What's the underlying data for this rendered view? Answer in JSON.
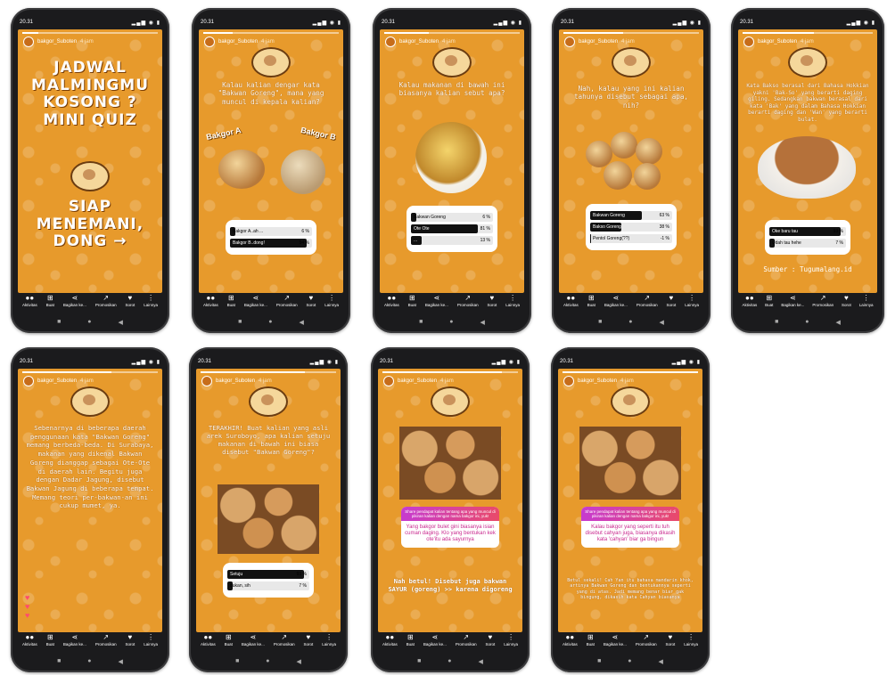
{
  "status": {
    "time": "20.31"
  },
  "story": {
    "user": "bakgor_Suboten",
    "age": "4 jam"
  },
  "actions": [
    "Aktivitas",
    "Buat",
    "Bagikan ke...",
    "Promosikan",
    "Sorot",
    "Lainnya"
  ],
  "slides": [
    {
      "big": [
        "JADWAL",
        "MALMINGMU",
        "KOSONG ?",
        "MINI QUIZ",
        "",
        "SIAP",
        "MENEMANI,",
        "DONG →"
      ]
    },
    {
      "question": "Kalau kalian dengar kata \"Bakwan Goreng\", mana yang muncul di kepala kalian?",
      "labelA": "Bakgor A",
      "labelB": "Bakgor B",
      "poll": [
        {
          "label": "Bakgor A..ah ...",
          "pct": "6 %",
          "value": 6
        },
        {
          "label": "Bakgor B..dong!",
          "pct": "94 %",
          "value": 94
        }
      ]
    },
    {
      "question": "Kalau makanan di bawah ini biasanya kalian sebut apa?",
      "poll": [
        {
          "label": "Bakwan Goreng",
          "pct": "6 %",
          "value": 6
        },
        {
          "label": "Ote Ote",
          "pct": "81 %",
          "value": 81
        },
        {
          "label": "...",
          "pct": "13 %",
          "value": 13
        }
      ]
    },
    {
      "question": "Nah, kalau yang ini kalian tahunya disebut sebagai apa, nih?",
      "poll": [
        {
          "label": "Bakwan Goreng",
          "pct": "63 %",
          "value": 63
        },
        {
          "label": "Bakso Goreng",
          "pct": "38 %",
          "value": 38
        },
        {
          "label": "Pentol Goreng(??)",
          "pct": "-1 %",
          "value": 1
        }
      ]
    },
    {
      "question": "Kata Bakso berasal dari Bahasa Hokkian yakni 'Bak-So' yang berarti daging giling. Sedangkan bakwan berasal dari kata 'Bak' yang dalam Bahasa Hokkian berarti daging dan 'Wan' yang berarti bulat.",
      "poll": [
        {
          "label": "Oke baru tau",
          "pct": "93 %",
          "value": 93
        },
        {
          "label": "Udah tau hehe",
          "pct": "7 %",
          "value": 7
        }
      ],
      "source": "Sumber : Tugumalang.id"
    },
    {
      "question": "Sebenarnya di beberapa daerah penggunaan kata \"Bakwan Goreng\" memang berbeda-beda. Di Surabaya, makanan yang dikenal Bakwan Goreng dianggap sebagai Ote-Ote di daerah lain. Begitu juga dengan Dadar Jagung, disebut Bakwan Jagung di beberapa tempat. Memang teori per-bakwan-an ini cukup mumet, ya."
    },
    {
      "question": "TERAKHIR! Buat kalian yang asli arek Suroboyo, apa kalian setuju makanan di bawah ini biasa disebut \"Bakwan Goreng\"?",
      "poll": [
        {
          "label": "Setuju",
          "pct": "93 %",
          "value": 93
        },
        {
          "label": "bukan, sih",
          "pct": "7 %",
          "value": 7
        }
      ]
    },
    {
      "qheader": "Share pendapat kalian tentang apa yang muncul di pikiran kalian dengan nama bakgor ini, yuk!",
      "answer": "Yang bakgor bulet gini biasanya isian cuman daging. Klo yang bentukan kek ote'itu ada sayurnya",
      "reply": "Nah betul! Disebut juga bakwan SAYUR (goreng) >> karena digoreng"
    },
    {
      "qheader": "Share pendapat kalian tentang apa yang muncul di pikiran kalian dengan nama bakgor ini, yuk!",
      "answer": "Kalau bakgor yang seperti itu tuh disebut cahyan juga, biasanya dikasih kata 'cahyan' biar ga bingun",
      "reply": "Betul sekali! Cah Yan itu bahasa mandarin khok, artinya Bakwan Goreng dan bentukannya seperti yang di atas. Jadi memang benar biar gak bingung, dikasih kata Cahyan biasanya"
    }
  ]
}
